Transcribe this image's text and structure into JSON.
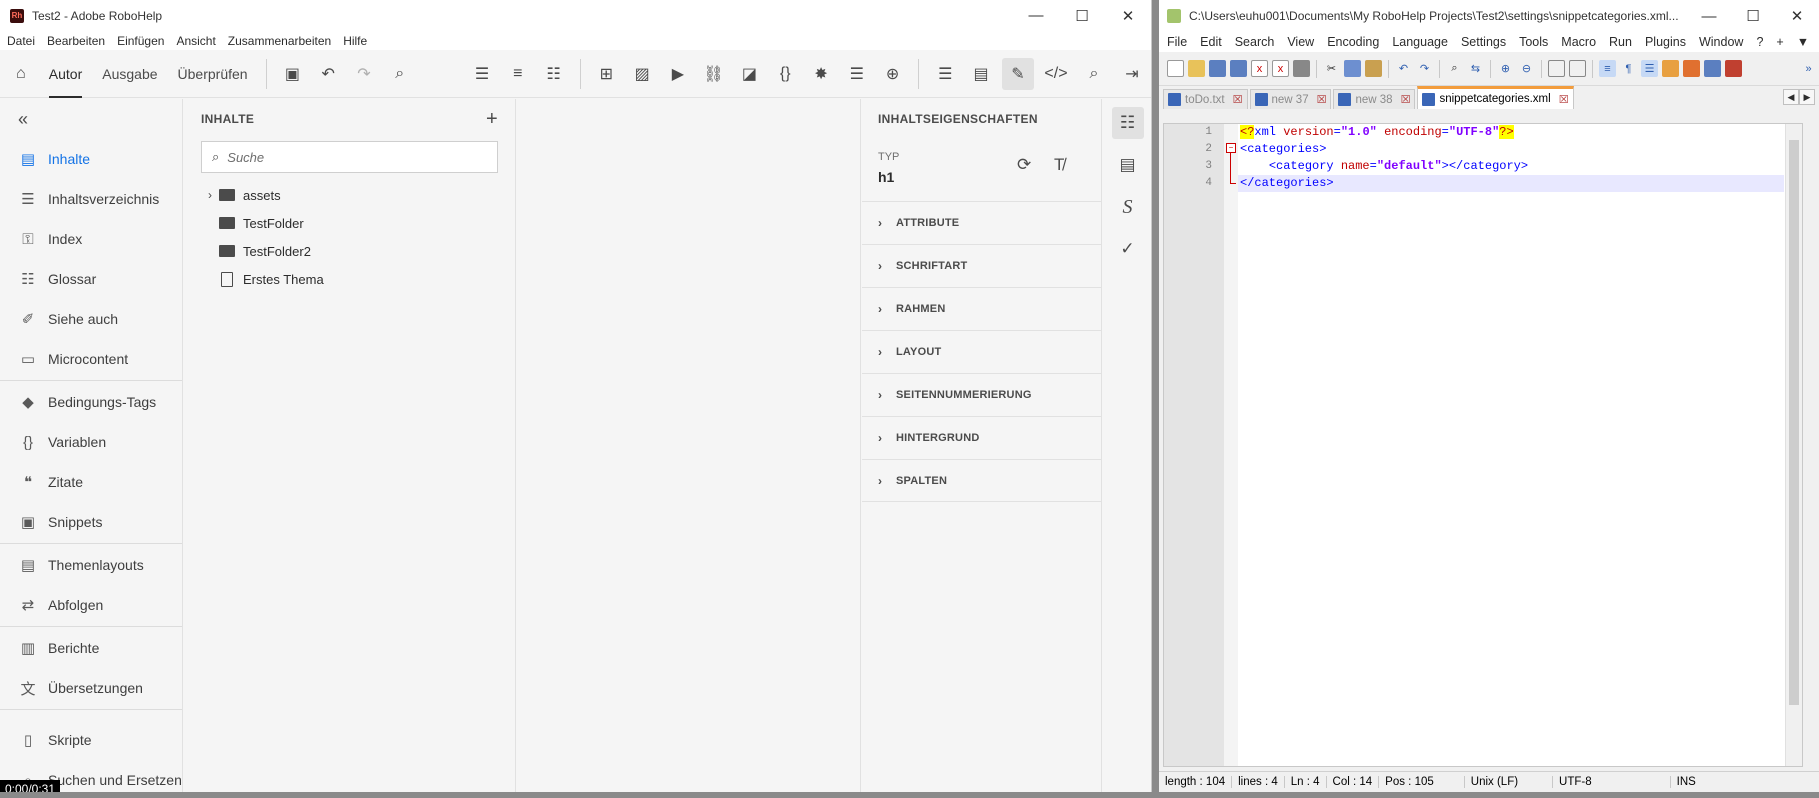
{
  "robohelp": {
    "title": "Test2 - Adobe RoboHelp",
    "app_icon": "Rh",
    "menu": [
      "Datei",
      "Bearbeiten",
      "Einfügen",
      "Ansicht",
      "Zusammenarbeiten",
      "Hilfe"
    ],
    "nav_tabs": [
      "Autor",
      "Ausgabe",
      "Überprüfen"
    ],
    "active_tab": "Autor",
    "sidebar": {
      "groups": [
        [
          {
            "label": "Inhalte",
            "icon": "document-lines-icon",
            "active": true
          },
          {
            "label": "Inhaltsverzeichnis",
            "icon": "toc-icon"
          },
          {
            "label": "Index",
            "icon": "key-icon"
          },
          {
            "label": "Glossar",
            "icon": "list-icon"
          },
          {
            "label": "Siehe auch",
            "icon": "see-also-icon"
          },
          {
            "label": "Microcontent",
            "icon": "microcontent-icon"
          }
        ],
        [
          {
            "label": "Bedingungs-Tags",
            "icon": "tag-icon"
          },
          {
            "label": "Variablen",
            "icon": "braces-icon"
          },
          {
            "label": "Zitate",
            "icon": "quote-icon"
          },
          {
            "label": "Snippets",
            "icon": "snippet-icon"
          }
        ],
        [
          {
            "label": "Themenlayouts",
            "icon": "layout-icon"
          },
          {
            "label": "Abfolgen",
            "icon": "sequence-icon"
          }
        ],
        [
          {
            "label": "Berichte",
            "icon": "report-icon"
          },
          {
            "label": "Übersetzungen",
            "icon": "translate-icon"
          }
        ],
        [
          {
            "label": "Skripte",
            "icon": "script-icon"
          },
          {
            "label": "Suchen und Ersetzen",
            "icon": "search-replace-icon"
          }
        ]
      ]
    },
    "content_panel": {
      "title": "INHALTE",
      "search_placeholder": "Suche",
      "tree": [
        {
          "label": "assets",
          "type": "folder",
          "expandable": true
        },
        {
          "label": "TestFolder",
          "type": "folder",
          "expandable": false
        },
        {
          "label": "TestFolder2",
          "type": "folder",
          "expandable": false
        },
        {
          "label": "Erstes Thema",
          "type": "topic",
          "expandable": false
        }
      ]
    },
    "properties_panel": {
      "title": "INHALTSEIGENSCHAFTEN",
      "type_label": "TYP",
      "type_value": "h1",
      "sections": [
        "ATTRIBUTE",
        "SCHRIFTART",
        "RAHMEN",
        "LAYOUT",
        "SEITENNUMMERIERUNG",
        "HINTERGRUND",
        "SPALTEN"
      ]
    },
    "timer": "0:00/0:31"
  },
  "notepad": {
    "title": "C:\\Users\\euhu001\\Documents\\My RoboHelp Projects\\Test2\\settings\\snippetcategories.xml...",
    "menu": [
      "File",
      "Edit",
      "Search",
      "View",
      "Encoding",
      "Language",
      "Settings",
      "Tools",
      "Macro",
      "Run",
      "Plugins",
      "Window",
      "?",
      "+",
      "▼"
    ],
    "tabs": [
      {
        "label": "toDo.txt",
        "active": false
      },
      {
        "label": "new 37",
        "active": false
      },
      {
        "label": "new 38",
        "active": false
      },
      {
        "label": "snippetcategories.xml",
        "active": true
      }
    ],
    "line_numbers": [
      "1",
      "2",
      "3",
      "4"
    ],
    "code": {
      "l1_pi_open": "<?",
      "l1_name": "xml",
      "l1_attr1": "version",
      "l1_val1": "\"1.0\"",
      "l1_attr2": "encoding",
      "l1_val2": "\"UTF-8\"",
      "l1_pi_close": "?>",
      "l2": "<categories>",
      "l3_open": "<category",
      "l3_attr": "name",
      "l3_val": "\"default\"",
      "l3_close": "></category>",
      "l4": "</categories>"
    },
    "status": {
      "length": "length : 104",
      "lines": "lines : 4",
      "ln": "Ln : 4",
      "col": "Col : 14",
      "pos": "Pos : 105",
      "eol": "Unix (LF)",
      "encoding": "UTF-8",
      "mode": "INS"
    }
  }
}
